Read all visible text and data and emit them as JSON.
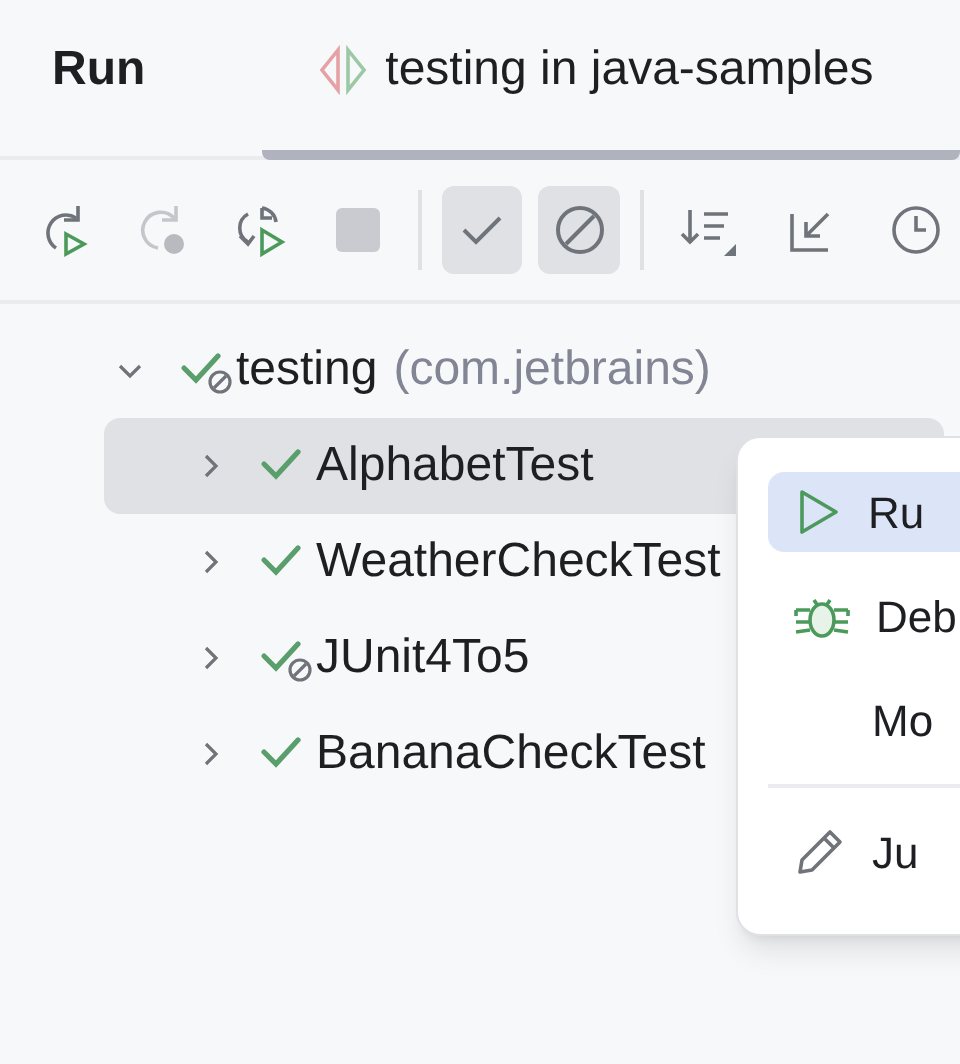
{
  "header": {
    "title": "Run",
    "tab": {
      "label": "testing in java-samples",
      "selected": true
    }
  },
  "toolbar": {
    "actions": [
      {
        "kind": "rerun",
        "disabled": false
      },
      {
        "kind": "rerun_failed",
        "disabled": true
      },
      {
        "kind": "toggle_rerun",
        "disabled": false
      },
      {
        "kind": "stop",
        "disabled": true
      }
    ],
    "filters": [
      {
        "kind": "passed",
        "selected": true
      },
      {
        "kind": "ignored",
        "selected": true
      }
    ],
    "tools": [
      {
        "kind": "sort"
      },
      {
        "kind": "collapse"
      },
      {
        "kind": "history"
      }
    ]
  },
  "tree": [
    {
      "label": "testing",
      "detail": "(com.jetbrains)",
      "ignored": true,
      "expanded": true,
      "selected": false,
      "children": [
        {
          "label": "AlphabetTest",
          "ignored": false,
          "expanded": false,
          "selected": true
        },
        {
          "label": "WeatherCheckTest",
          "ignored": false,
          "expanded": false,
          "selected": false
        },
        {
          "label": "JUnit4To5",
          "ignored": true,
          "expanded": false,
          "selected": false
        },
        {
          "label": "BananaCheckTest",
          "ignored": false,
          "expanded": false,
          "selected": false
        }
      ]
    }
  ],
  "context_menu": [
    {
      "kind": "run",
      "label": "Ru",
      "selected": true,
      "separator_before": false
    },
    {
      "kind": "debug",
      "label": "Deb",
      "selected": false,
      "separator_before": false
    },
    {
      "kind": "more",
      "label": "Mo",
      "selected": false,
      "separator_before": false
    },
    {
      "kind": "edit",
      "label": "Ju",
      "selected": false,
      "separator_before": true
    }
  ]
}
